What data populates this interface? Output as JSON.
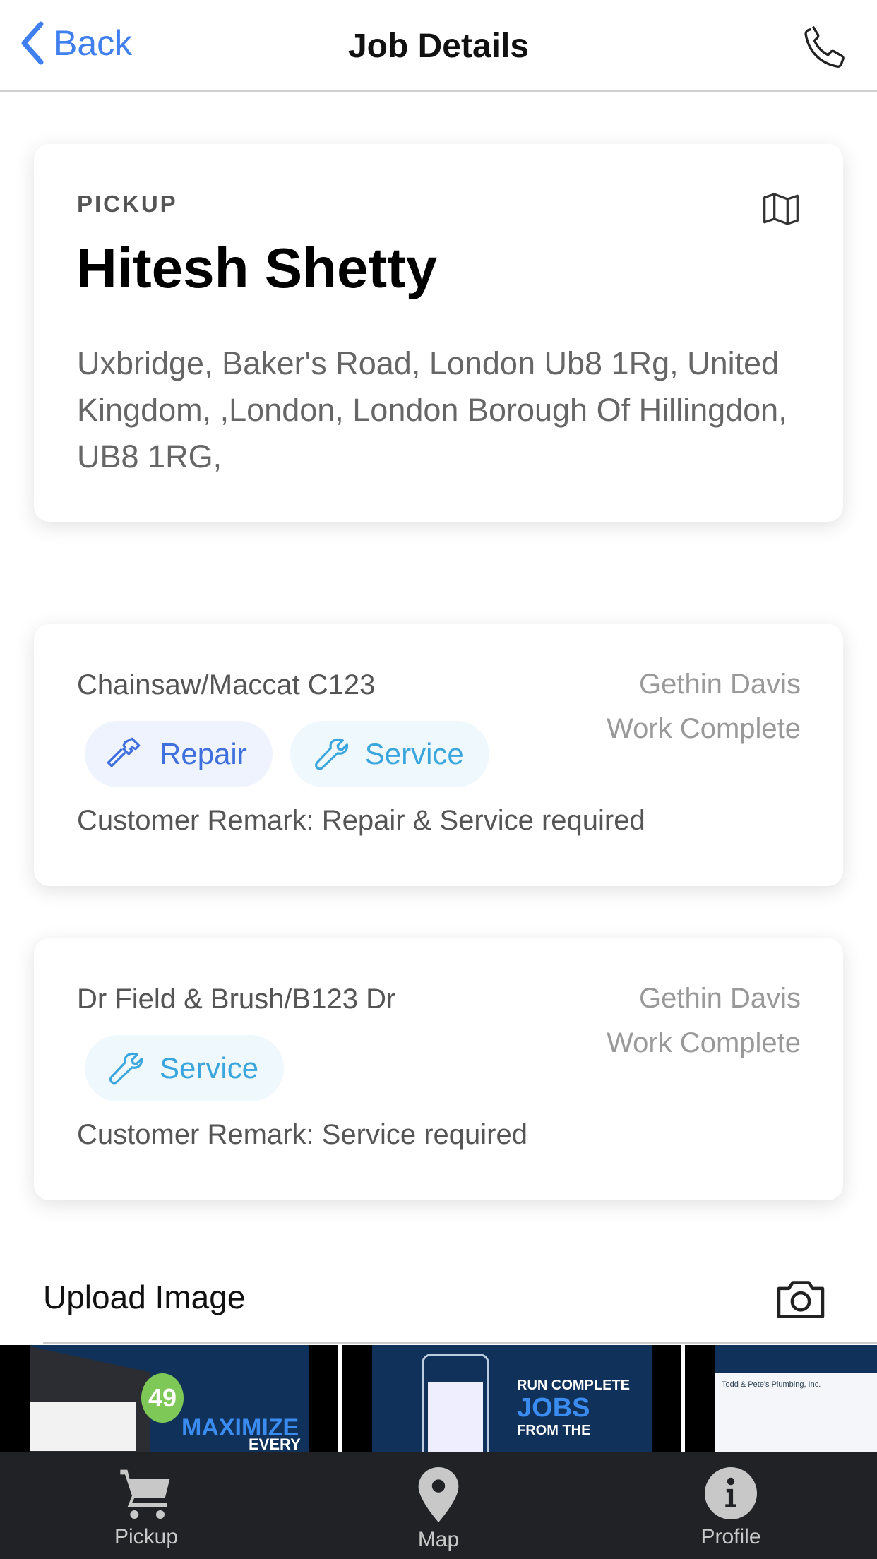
{
  "header": {
    "back_label": "Back",
    "title": "Job Details",
    "call_icon": "phone-icon"
  },
  "pickup": {
    "label": "PICKUP",
    "name": "Hitesh Shetty",
    "address": "Uxbridge, Baker's Road, London Ub8 1Rg, United Kingdom, ,London, London Borough Of Hillingdon, UB8 1RG,",
    "map_icon": "map-icon"
  },
  "jobs": [
    {
      "item": "Chainsaw/Maccat C123",
      "technician": "Gethin Davis",
      "status": "Work Complete",
      "tags": {
        "repair": "Repair",
        "service": "Service"
      },
      "remark": "Customer Remark: Repair & Service required"
    },
    {
      "item": "Dr Field & Brush/B123 Dr",
      "technician": "Gethin Davis",
      "status": "Work Complete",
      "tags": {
        "service": "Service"
      },
      "remark": "Customer Remark: Service required"
    }
  ],
  "upload": {
    "label": "Upload Image",
    "camera_icon": "camera-icon"
  },
  "images": [
    {
      "badge": "49",
      "headline": "MAXIMIZE",
      "sub": "EVERY"
    },
    {
      "line1": "RUN COMPLETE",
      "line2": "JOBS",
      "line3": "FROM THE"
    },
    {
      "caption": "Todd & Pete's Plumbing, Inc."
    }
  ],
  "colors": {
    "accent": "#3f7ff0",
    "repair": "#3e6fdc",
    "service": "#3ba6de",
    "nav_bg": "#212225"
  },
  "nav": {
    "items": [
      {
        "label": "Pickup",
        "icon": "cart-icon"
      },
      {
        "label": "Map",
        "icon": "map-pin-icon"
      },
      {
        "label": "Profile",
        "icon": "info-icon"
      }
    ]
  }
}
